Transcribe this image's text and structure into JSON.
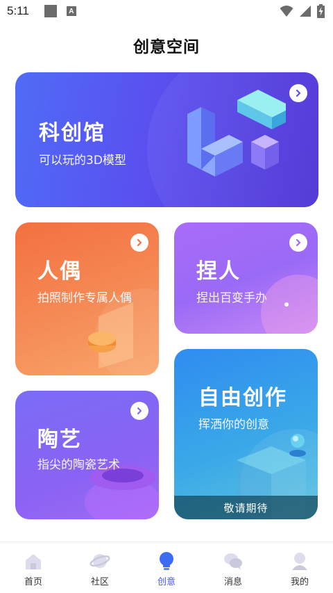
{
  "status": {
    "time": "5:11",
    "notif_glyph": "A"
  },
  "header": {
    "title": "创意空间"
  },
  "cards": {
    "kechuang": {
      "title": "科创馆",
      "subtitle": "可以玩的3D模型"
    },
    "ouren": {
      "title": "人偶",
      "subtitle": "拍照制作专属人偶"
    },
    "nieren": {
      "title": "捏人",
      "subtitle": "捏出百变手办"
    },
    "taoyi": {
      "title": "陶艺",
      "subtitle": "指尖的陶瓷艺术"
    },
    "ziyou": {
      "title": "自由创作",
      "subtitle": "挥洒你的创意",
      "coming_label": "敬请期待"
    }
  },
  "nav": {
    "active": "创意",
    "items": [
      {
        "label": "首页",
        "icon": "home-icon"
      },
      {
        "label": "社区",
        "icon": "planet-icon"
      },
      {
        "label": "创意",
        "icon": "lightbulb-icon"
      },
      {
        "label": "消息",
        "icon": "chat-bubbles-icon"
      },
      {
        "label": "我的",
        "icon": "profile-icon"
      }
    ]
  },
  "colors": {
    "accent": "#4a55ee",
    "kechuang": "#5a4ff0",
    "ouren": "#f58b56",
    "nieren": "#9a6af6",
    "taoyi": "#8a62f4",
    "ziyou": "#3aa8e8"
  }
}
